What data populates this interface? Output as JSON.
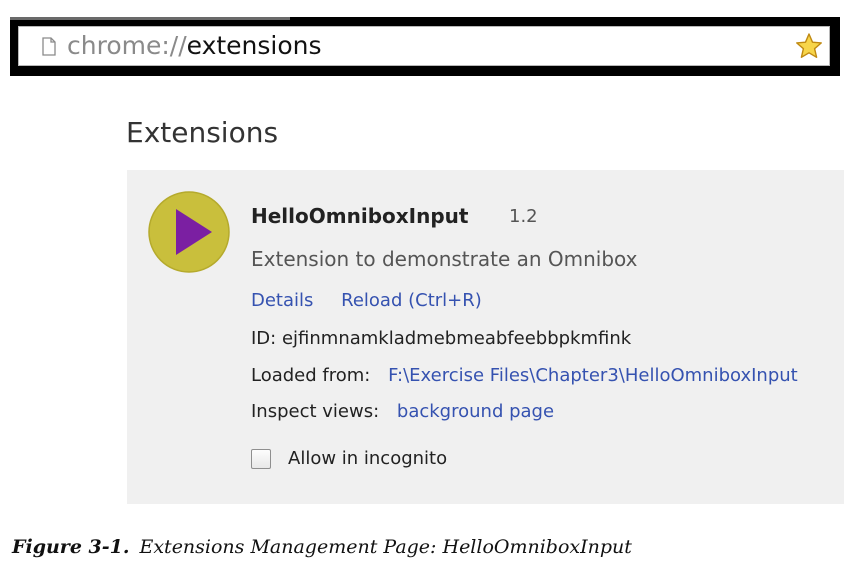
{
  "browser": {
    "omnibox": {
      "scheme": "chrome://",
      "host": "extensions",
      "page_icon": "page-icon",
      "bookmark_icon": "star-icon"
    }
  },
  "page": {
    "title": "Extensions"
  },
  "extension": {
    "icon": "play-icon",
    "name": "HelloOmniboxInput",
    "version": "1.2",
    "description": "Extension to demonstrate an Omnibox",
    "links": {
      "details": "Details",
      "reload": "Reload (Ctrl+R)"
    },
    "id_label": "ID:",
    "id": "ejfinmnamkladmebmeabfeebbpkmfink",
    "loaded_from_label": "Loaded from:",
    "loaded_from": "F:\\Exercise Files\\Chapter3\\HelloOmniboxInput",
    "inspect_views_label": "Inspect views:",
    "inspect_views": "background page",
    "incognito": {
      "label": "Allow in incognito",
      "checked": false
    }
  },
  "caption": {
    "number": "Figure 3-1.",
    "text": "Extensions Management Page: HelloOmniboxInput"
  },
  "colors": {
    "card_background": "#f0f0f0",
    "link": "#3552b0",
    "icon_circle": "#c9bf3c",
    "icon_play": "#7b1fa2"
  }
}
